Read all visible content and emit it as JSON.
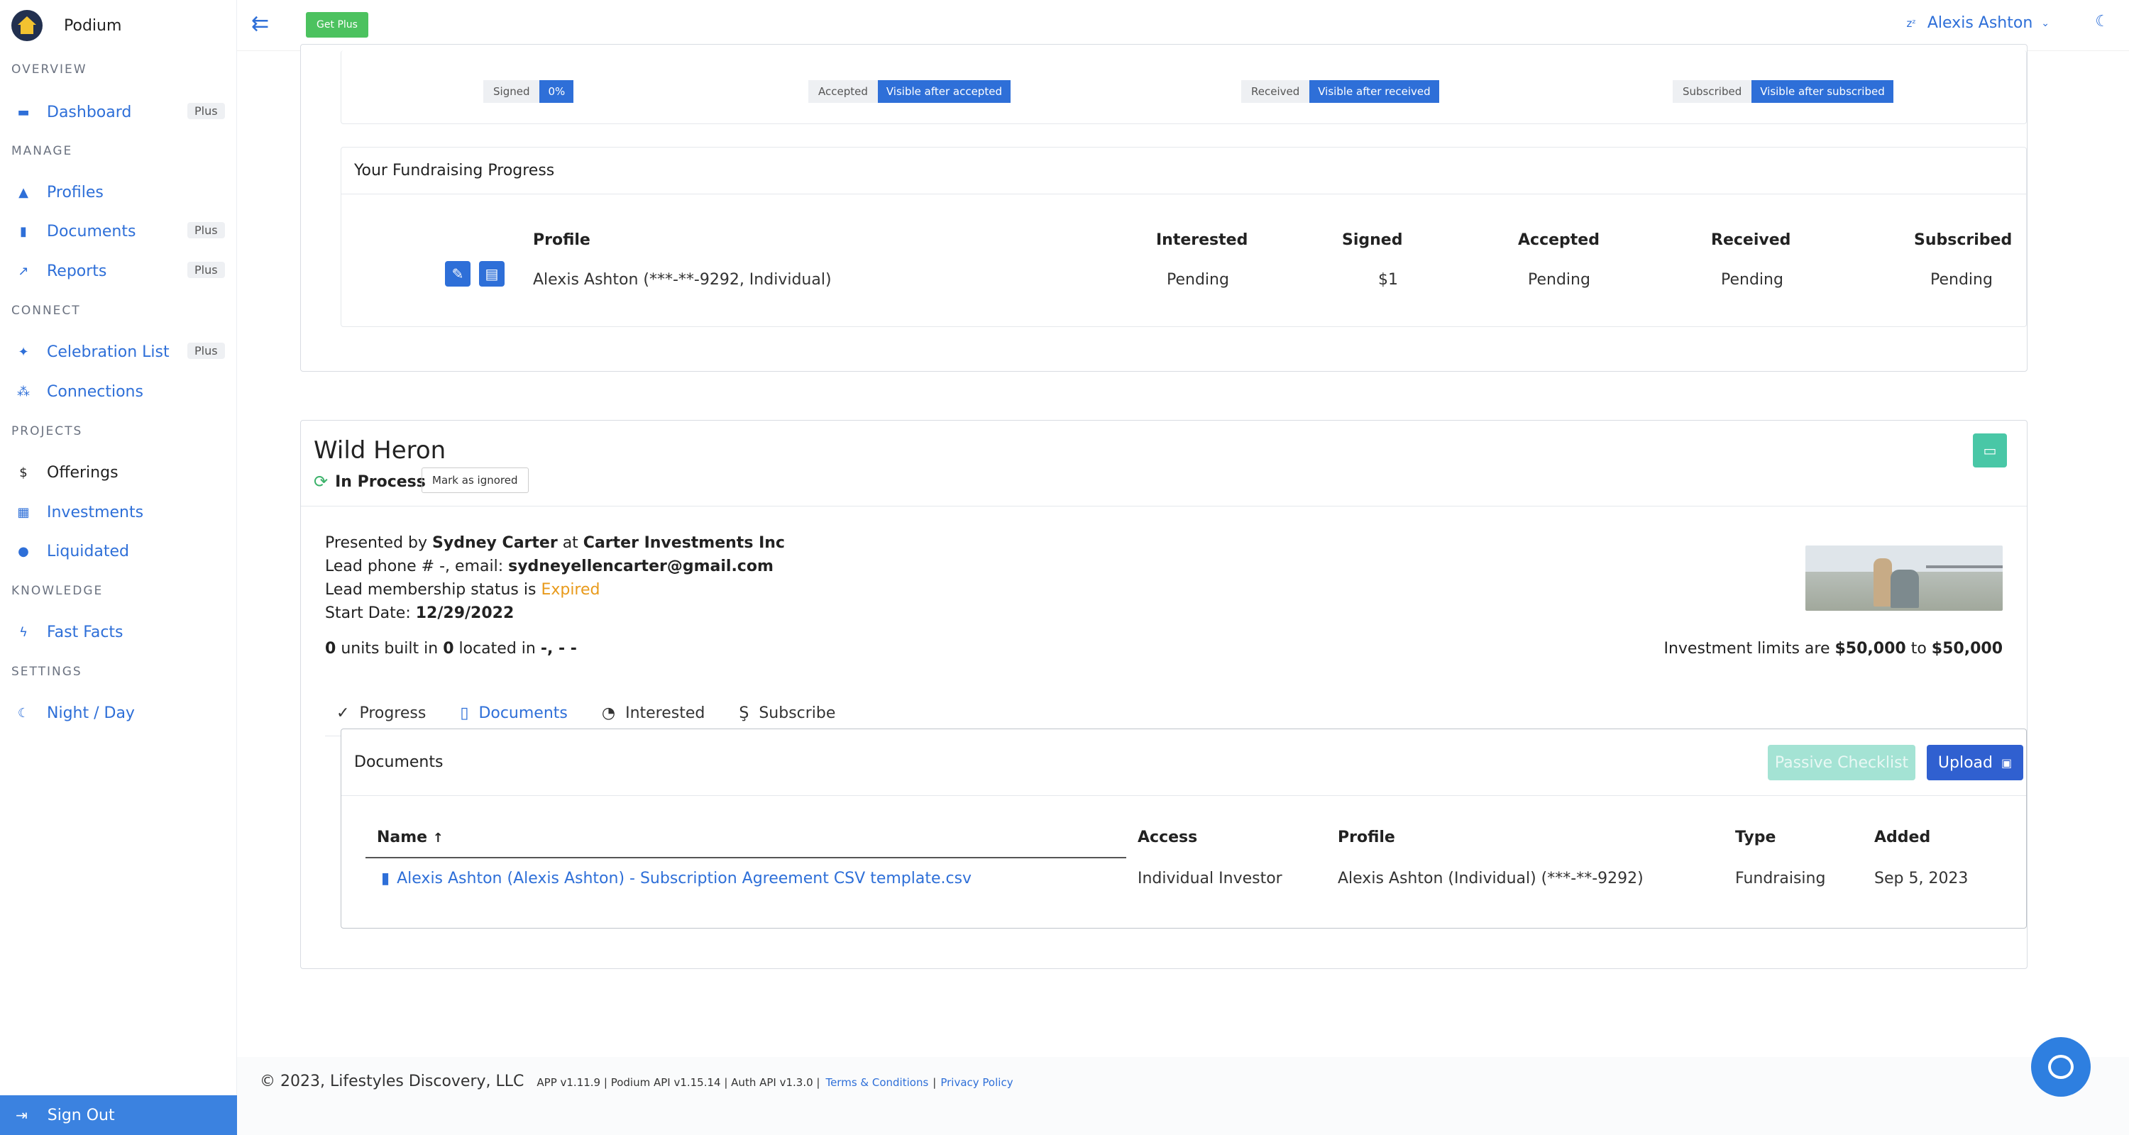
{
  "app": {
    "name": "Podium",
    "get_plus": "Get Plus"
  },
  "user": {
    "name": "Alexis Ashton"
  },
  "sidebar": {
    "sections": [
      {
        "title": "OVERVIEW"
      },
      {
        "title": "MANAGE"
      },
      {
        "title": "CONNECT"
      },
      {
        "title": "PROJECTS"
      },
      {
        "title": "KNOWLEDGE"
      },
      {
        "title": "SETTINGS"
      }
    ],
    "items": [
      {
        "label": "Dashboard",
        "badge": "Plus",
        "icon": "dashboard-icon"
      },
      {
        "label": "Profiles",
        "icon": "profiles-icon"
      },
      {
        "label": "Documents",
        "badge": "Plus",
        "icon": "document-icon"
      },
      {
        "label": "Reports",
        "badge": "Plus",
        "icon": "chart-icon"
      },
      {
        "label": "Celebration List",
        "badge": "Plus",
        "icon": "party-icon"
      },
      {
        "label": "Connections",
        "icon": "connections-icon"
      },
      {
        "label": "Offerings",
        "icon": "dollar-icon"
      },
      {
        "label": "Investments",
        "icon": "building-icon"
      },
      {
        "label": "Liquidated",
        "icon": "minus-circle-icon"
      },
      {
        "label": "Fast Facts",
        "icon": "lightning-icon"
      },
      {
        "label": "Night / Day",
        "icon": "moon-icon"
      }
    ],
    "sign_out": "Sign Out"
  },
  "stats": {
    "signed": {
      "label": "Signed",
      "value": "0%"
    },
    "accepted": {
      "label": "Accepted",
      "value": "Visible after accepted"
    },
    "received": {
      "label": "Received",
      "value": "Visible after received"
    },
    "subscribed": {
      "label": "Subscribed",
      "value": "Visible after subscribed"
    }
  },
  "fundraising": {
    "title": "Your Fundraising Progress",
    "columns": [
      "Profile",
      "Interested",
      "Signed",
      "Accepted",
      "Received",
      "Subscribed"
    ],
    "row": {
      "profile": "Alexis Ashton (***-**-9292, Individual)",
      "interested": "Pending",
      "signed": "$1",
      "accepted": "Pending",
      "received": "Pending",
      "subscribed": "Pending"
    }
  },
  "offering": {
    "title": "Wild Heron",
    "status": "In Process",
    "mark_ignored": "Mark as ignored",
    "presented_prefix": "Presented by",
    "presenter": "Sydney Carter",
    "at": "at",
    "company": "Carter Investments Inc",
    "lead_contact_prefix": "Lead phone # -, email:",
    "email": "sydneyellencarter@gmail.com",
    "membership_prefix": "Lead membership status is",
    "membership_status": "Expired",
    "start_prefix": "Start Date:",
    "start_date": "12/29/2022",
    "units_built": "0",
    "units_text": "units built in",
    "located_count": "0",
    "located_text": "located in",
    "location": "-, - -",
    "limits_prefix": "Investment limits are",
    "limit_min": "$50,000",
    "limit_to": "to",
    "limit_max": "$50,000",
    "tabs": [
      {
        "label": "Progress",
        "icon": "check-circle-icon"
      },
      {
        "label": "Documents",
        "icon": "document-icon"
      },
      {
        "label": "Interested",
        "icon": "gauge-icon"
      },
      {
        "label": "Subscribe",
        "icon": "signature-icon"
      }
    ]
  },
  "documents": {
    "title": "Documents",
    "passive_checklist": "Passive Checklist",
    "upload": "Upload",
    "columns": {
      "name": "Name",
      "access": "Access",
      "profile": "Profile",
      "type": "Type",
      "added": "Added"
    },
    "rows": [
      {
        "name": "Alexis Ashton (Alexis Ashton) - Subscription Agreement CSV template.csv",
        "access": "Individual Investor",
        "profile": "Alexis Ashton (Individual) (***-**-9292)",
        "type": "Fundraising",
        "added": "Sep 5, 2023"
      }
    ]
  },
  "footer": {
    "copyright": "© 2023, Lifestyles Discovery, LLC",
    "versions": "APP v1.11.9 | Podium API v1.15.14 | Auth API v1.3.0 |",
    "terms": "Terms & Conditions",
    "sep": "|",
    "privacy": "Privacy Policy"
  },
  "colors": {
    "accent": "#2e6fd8",
    "success": "#4cc25f",
    "teal": "#49c7a6",
    "warning": "#e89a1b"
  }
}
